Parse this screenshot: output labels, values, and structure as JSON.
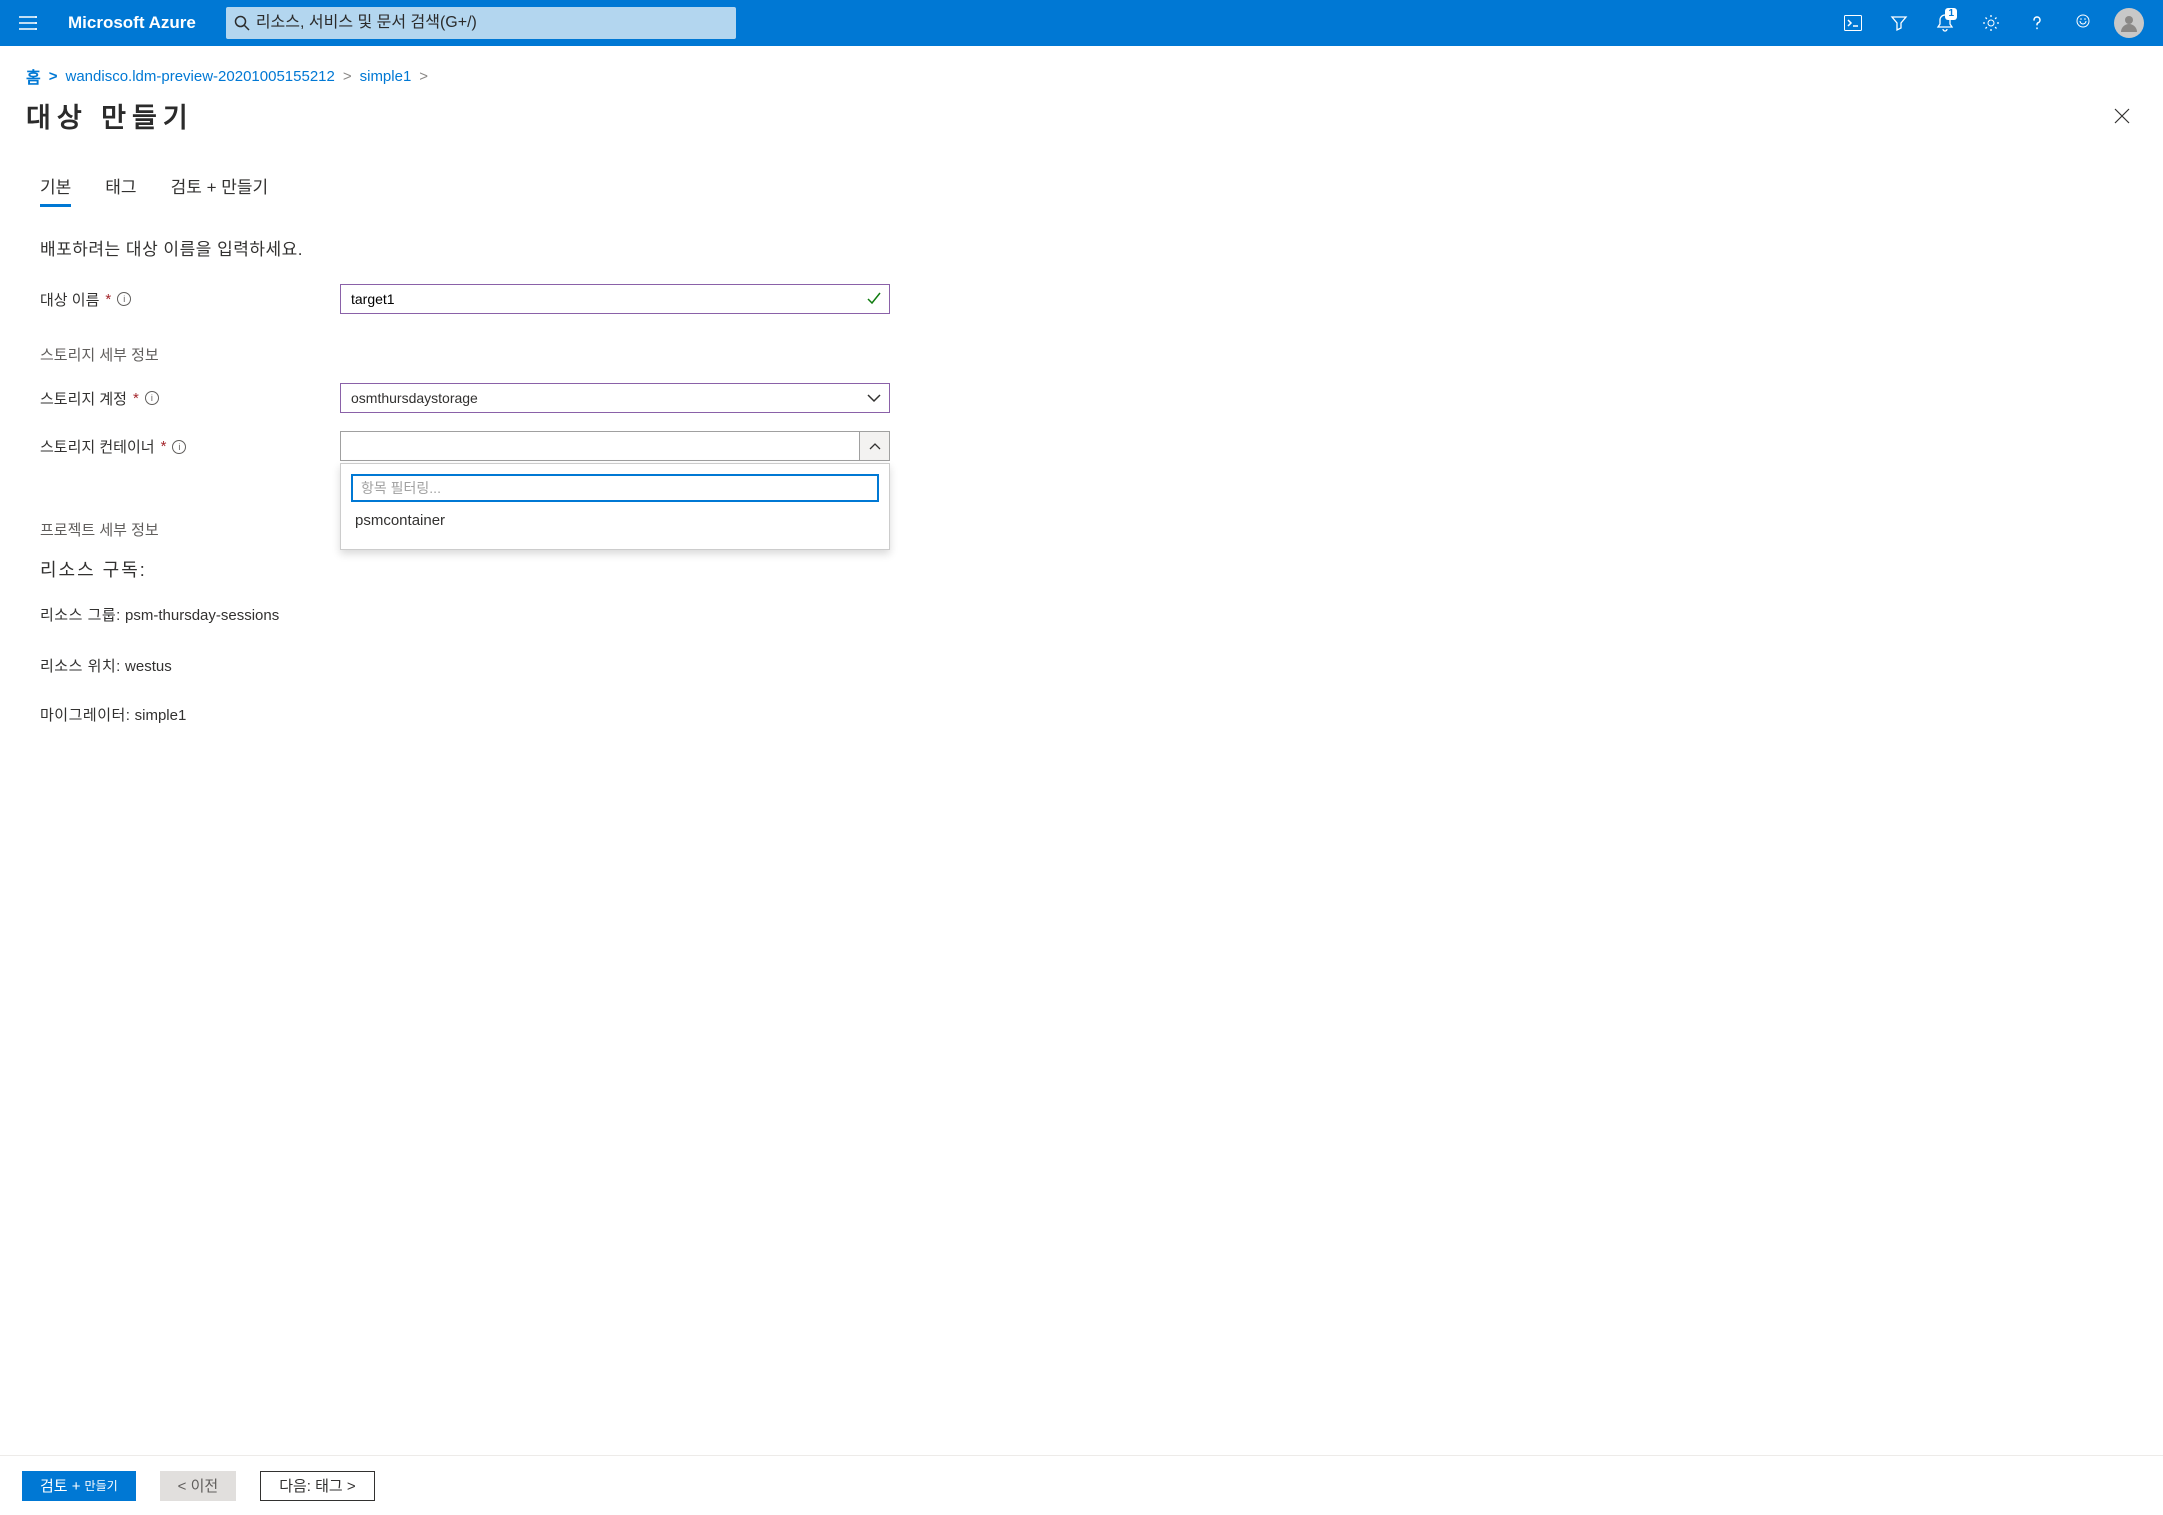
{
  "topbar": {
    "brand": "Microsoft Azure",
    "search_placeholder": "리소스, 서비스 및 문서 검색(G+/)",
    "notification_count": "1"
  },
  "breadcrumb": {
    "home": "홈",
    "item1": "wandisco.ldm-preview-20201005155212",
    "item2": "simple1"
  },
  "page": {
    "title": "대상 만들기"
  },
  "tabs": {
    "basic": "기본",
    "tags": "태그",
    "review": "검토 + 만들기"
  },
  "instruction": "배포하려는 대상 이름을 입력하세요.",
  "form": {
    "target_name_label": "대상 이름",
    "target_name_value": "target1",
    "storage_heading": "스토리지 세부 정보",
    "storage_account_label": "스토리지 계정",
    "storage_account_value": "osmthursdaystorage",
    "storage_container_label": "스토리지 컨테이너",
    "storage_container_value": "",
    "filter_placeholder": "항목 필터링...",
    "container_options": [
      "psmcontainer"
    ]
  },
  "project": {
    "heading": "프로젝트 세부 정보",
    "subscription_label": "리소스 구독:",
    "resource_group_label": "리소스 그룹:",
    "resource_group_value": "psm-thursday-sessions",
    "location_label": "리소스 위치:",
    "location_value": "westus",
    "migrator_label": "마이그레이터:",
    "migrator_value": "simple1"
  },
  "footer": {
    "review_create": "검토 +",
    "review_create_sm": "만들기",
    "previous": "< 이전",
    "next": "다음: 태그 >"
  }
}
